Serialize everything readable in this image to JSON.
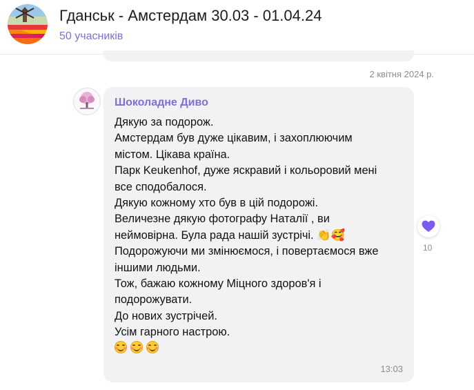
{
  "header": {
    "title": "Гданськ - Амстердам 30.03 - 01.04.24",
    "members": "50 учасників",
    "avatar_icon": "tulip-field-windmill-photo"
  },
  "feed": {
    "date_separator": "2 квітня 2024 р.",
    "message": {
      "sender": "Шоколадне Диво",
      "avatar_icon": "pink-tree-logo",
      "lines": [
        "Дякую за подорож.",
        "Амстердам був дуже цікавим, і захоплюючим",
        "містом. Цікава країна.",
        "Парк Keukenhof, дуже яскравий і кольоровий мені",
        "все сподобалося.",
        "Дякую кожному хто був в цій подорожі.",
        "Величезне дякую фотографу Наталії , ви",
        "неймовірна. Була рада нашій зустрічі. 👏🥰",
        "Подорожуючи ми змінюємося, і повертаємося вже",
        "іншими людьми.",
        "Тож, бажаю кожному Міцного здоров'я і",
        "подорожувати.",
        "До нових зустрічей.",
        "Усім гарного настрою."
      ],
      "emoji_line": [
        "smiling-face-icon",
        "smiling-face-icon",
        "smiling-face-icon"
      ],
      "time": "13:03"
    },
    "reaction": {
      "icon": "heart-icon",
      "color": "#7b5cf0",
      "count": "10"
    }
  },
  "colors": {
    "accent": "#7e6fd6",
    "bubble": "#f2f2f5",
    "muted": "#8c8c8c"
  }
}
